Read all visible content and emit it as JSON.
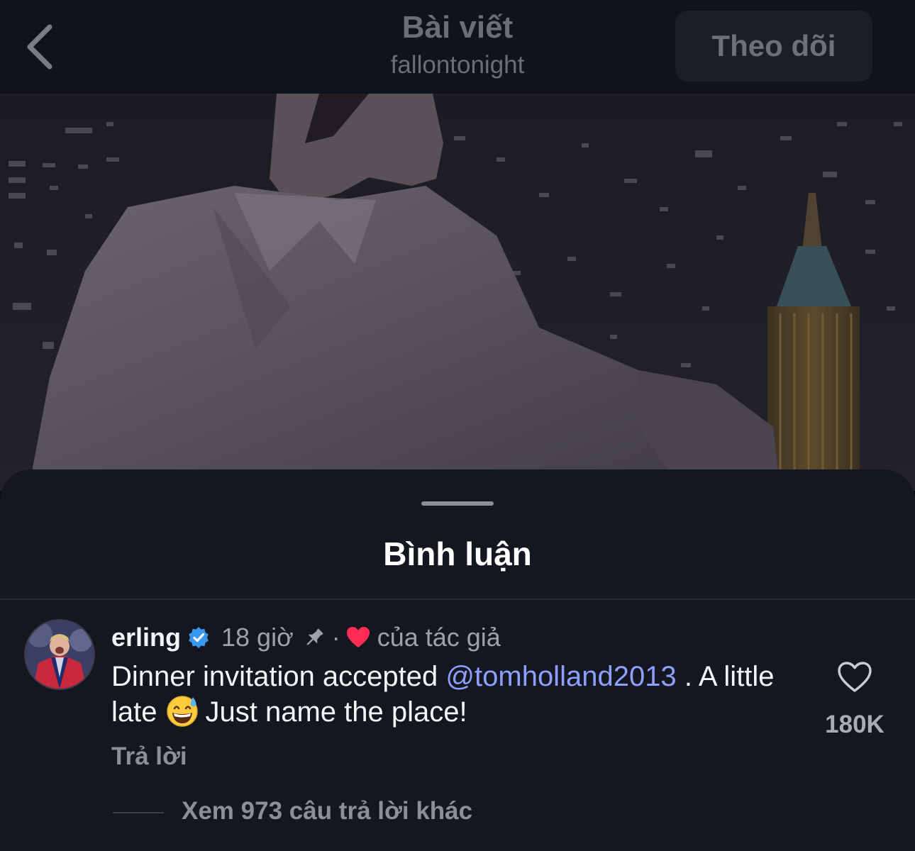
{
  "header": {
    "title": "Bài viết",
    "username": "fallontonight",
    "follow_label": "Theo dõi"
  },
  "sheet": {
    "title": "Bình luận"
  },
  "comment": {
    "username": "erling",
    "verified": true,
    "time": "18 giờ",
    "separator": "·",
    "liked_by_author": "của tác giả",
    "text_before": "Dinner invitation accepted",
    "mention": "@tomholland2013",
    "text_mid": ". A little late",
    "emoji": "grinning-face-with-sweat-icon",
    "text_after": "Just name the place!",
    "reply_label": "Trả lời",
    "like_count": "180K",
    "view_replies_label": "Xem 973 câu trả lời khác"
  },
  "colors": {
    "background": "#0b0d14",
    "sheet": "#141620",
    "mention": "#8ea0ff",
    "heart": "#ff2d55",
    "verified": "#3897f0"
  }
}
